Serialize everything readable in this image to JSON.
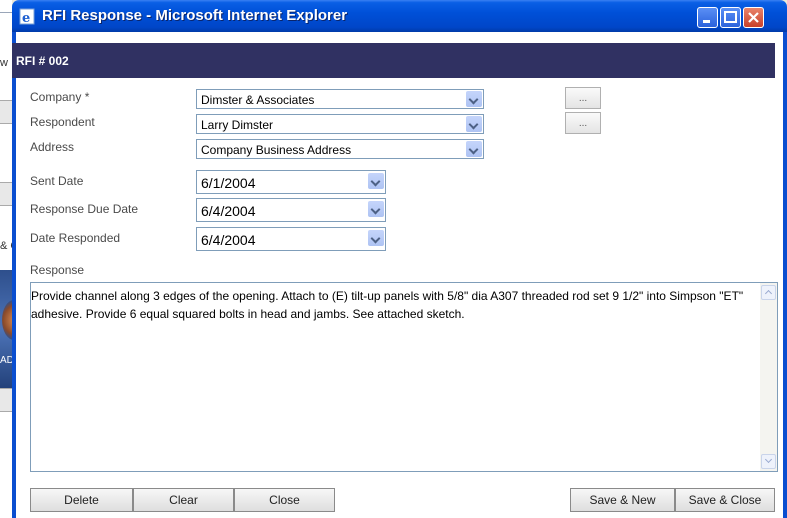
{
  "background": {
    "snippets": [
      "w",
      "& C",
      "ADM"
    ]
  },
  "window": {
    "title": "RFI Response - Microsoft Internet Explorer",
    "header": "RFI # 002"
  },
  "form": {
    "company_label": "Company *",
    "company_value": "Dimster & Associates",
    "respondent_label": "Respondent",
    "respondent_value": "Larry Dimster",
    "address_label": "Address",
    "address_value": "Company Business Address",
    "sent_date_label": "Sent Date",
    "sent_date_value": "6/1/2004",
    "due_date_label": "Response Due Date",
    "due_date_value": "6/4/2004",
    "responded_label": "Date Responded",
    "responded_value": "6/4/2004",
    "response_label": "Response",
    "response_text": "Provide channel along 3 edges of the opening.  Attach to (E) tilt-up panels with 5/8\" dia A307 threaded rod set 9 1/2\" into Simpson \"ET\" adhesive.  Provide 6 equal squared bolts in head and jambs.  See attached sketch.",
    "ellipsis": "..."
  },
  "buttons": {
    "delete": "Delete",
    "clear": "Clear",
    "close": "Close",
    "save_new": "Save & New",
    "save_close": "Save & Close"
  }
}
